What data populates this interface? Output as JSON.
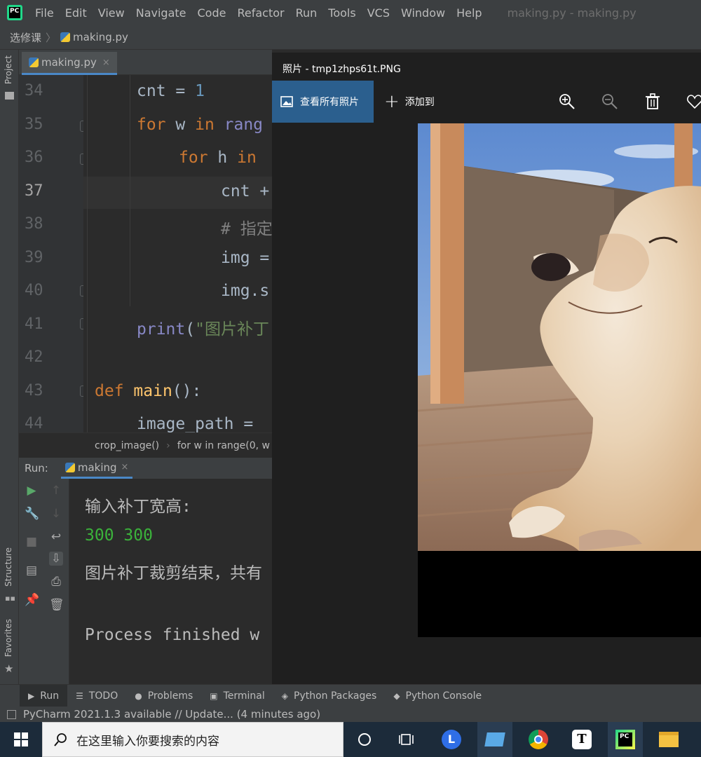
{
  "menu": {
    "items": [
      "File",
      "Edit",
      "View",
      "Navigate",
      "Code",
      "Refactor",
      "Run",
      "Tools",
      "VCS",
      "Window",
      "Help"
    ],
    "window_title": "making.py - making.py",
    "logo_text": "PC"
  },
  "breadcrumb": {
    "project": "选修课",
    "file": "making.py"
  },
  "left_strip": {
    "project": "Project",
    "structure": "Structure",
    "favorites": "Favorites"
  },
  "editor": {
    "tab_label": "making.py",
    "line_numbers": [
      "34",
      "35",
      "36",
      "37",
      "38",
      "39",
      "40",
      "41",
      "42",
      "43",
      "44"
    ],
    "lines": {
      "l34_var": "cnt",
      "l34_op": " = ",
      "l34_num": "1",
      "l35_kw": "for",
      "l35_var": " w ",
      "l35_kw2": "in",
      "l35_rest": " rang",
      "l36_kw": "for",
      "l36_var": " h ",
      "l36_kw2": "in",
      "l37": "cnt +",
      "l38": "# 指定",
      "l39": "img =",
      "l40": "img.s",
      "l41_fn": "print",
      "l41_p": "(",
      "l41_str": "\"图片补丁",
      "l43_kw": "def",
      "l43_fn": "main",
      "l43_rest": "():",
      "l44": "image_path ="
    },
    "breadcrumb_fn": "crop_image()",
    "breadcrumb_loop": "for w in range(0, w"
  },
  "run": {
    "label": "Run:",
    "tab": "making",
    "output": [
      "输入补丁宽高:",
      "300 300",
      "图片补丁裁剪结束，共有",
      "Process finished w"
    ]
  },
  "photos": {
    "title": "照片 - tmp1zhps61t.PNG",
    "view_all": "查看所有照片",
    "add_to": "添加到",
    "icons": [
      "zoom-in-icon",
      "zoom-out-icon",
      "delete-icon",
      "heart-icon"
    ]
  },
  "bottom_tools": [
    "Run",
    "TODO",
    "Problems",
    "Terminal",
    "Python Packages",
    "Python Console"
  ],
  "status": "PyCharm 2021.1.3 available // Update... (4 minutes ago)",
  "taskbar": {
    "search_placeholder": "在这里输入你要搜索的内容",
    "apps": [
      "cortana-icon",
      "task-view-icon",
      "l-app-icon",
      "computer-icon",
      "chrome-icon",
      "typora-icon",
      "pycharm-icon",
      "file-explorer-icon"
    ]
  }
}
